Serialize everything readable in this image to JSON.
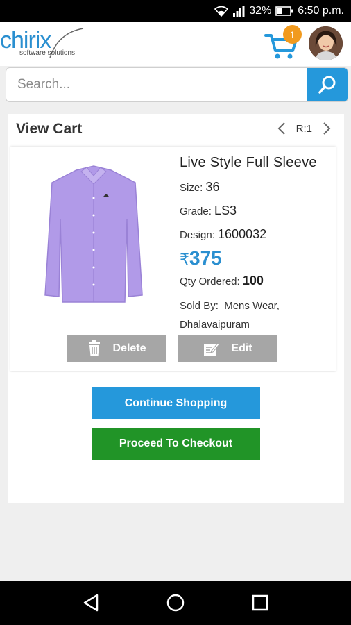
{
  "status_bar": {
    "battery": "32%",
    "time": "6:50 p.m."
  },
  "header": {
    "logo_text": "chirix",
    "logo_tagline": "software solutions",
    "cart_count": "1"
  },
  "search": {
    "placeholder": "Search..."
  },
  "cart": {
    "title": "View Cart",
    "pager_label": "R:1",
    "item": {
      "name": "Live Style Full Sleeve",
      "size_label": "Size:",
      "size_value": "36",
      "grade_label": "Grade:",
      "grade_value": "LS3",
      "design_label": "Design:",
      "design_value": "1600032",
      "currency": "₹",
      "price": "375",
      "qty_label": "Qty Ordered:",
      "qty_value": "100",
      "sold_by_label": "Sold By:",
      "sold_by_value": "Mens Wear,",
      "sold_by_location": "Dhalavaipuram",
      "product_color": "#b19ae8"
    },
    "delete_label": "Delete",
    "edit_label": "Edit",
    "continue_label": "Continue Shopping",
    "checkout_label": "Proceed To Checkout"
  },
  "colors": {
    "accent": "#2598db",
    "checkout": "#219427",
    "badge": "#f19a1e",
    "secondary": "#a6a6a6"
  }
}
